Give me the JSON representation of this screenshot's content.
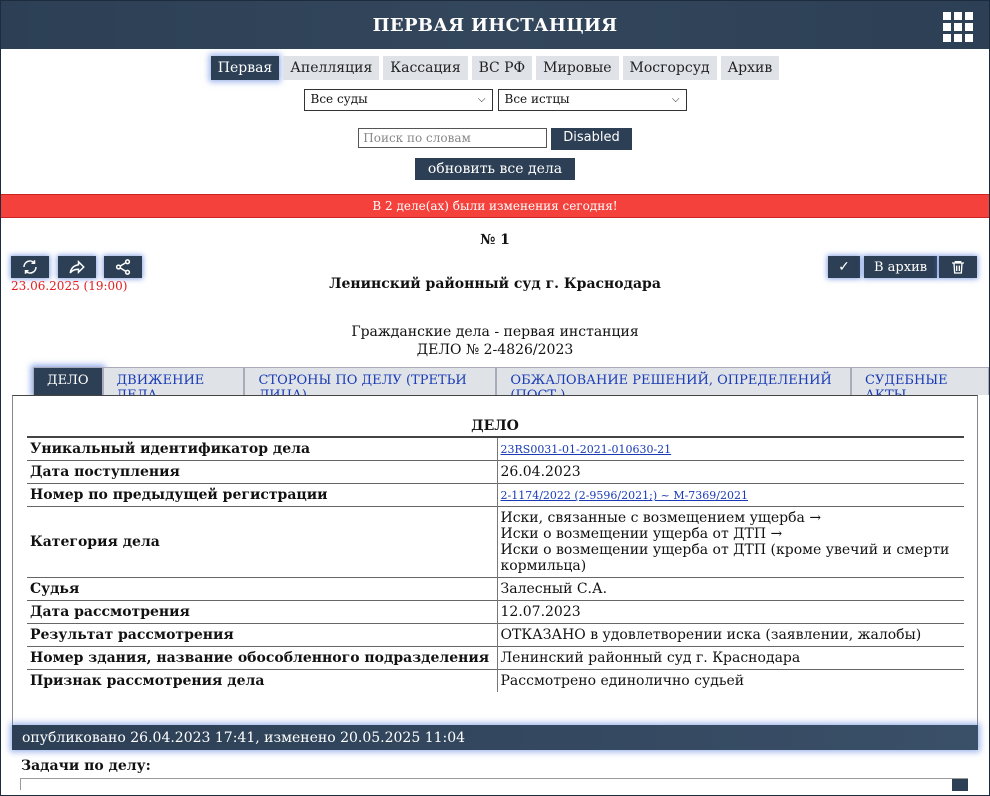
{
  "header": {
    "title": "ПЕРВАЯ ИНСТАНЦИЯ"
  },
  "courts": [
    "Первая",
    "Апелляция",
    "Кассация",
    "ВС РФ",
    "Мировые",
    "Мосгорсуд",
    "Архив"
  ],
  "filters": {
    "court_select": "Все суды",
    "plaintiff_select": "Все истцы"
  },
  "search": {
    "placeholder": "Поиск по словам",
    "disabled_label": "Disabled"
  },
  "refresh_label": "обновить все дела",
  "alert": "В 2 деле(ах) были изменения сегодня!",
  "case": {
    "number": "№ 1",
    "date": "23.06.2025 (19:00)",
    "court": "Ленинский районный суд г. Краснодара",
    "subtitle1": "Гражданские дела - первая инстанция",
    "subtitle2": "ДЕЛО № 2-4826/2023",
    "archive_label": "В архив",
    "check_label": "✓"
  },
  "tabs": [
    "ДЕЛО",
    "ДВИЖЕНИЕ ДЕЛА",
    "СТОРОНЫ ПО ДЕЛУ (ТРЕТЬИ ЛИЦА)",
    "ОБЖАЛОВАНИЕ РЕШЕНИЙ, ОПРЕДЕЛЕНИЙ (ПОСТ.)",
    "СУДЕБНЫЕ АКТЫ"
  ],
  "panel": {
    "title": "ДЕЛО",
    "rows": [
      {
        "key": "Уникальный идентификатор дела",
        "value": "23RS0031-01-2021-010630-21"
      },
      {
        "key": "Дата поступления",
        "value": "26.04.2023"
      },
      {
        "key": "Номер по предыдущей регистрации",
        "value": "2-1174/2022 (2-9596/2021;) ~ М-7369/2021"
      },
      {
        "key": "Категория дела",
        "value_lines": [
          "Иски, связанные с возмещением ущерба →",
          "Иски о возмещении ущерба от ДТП →",
          "Иски о возмещении ущерба от ДТП (кроме увечий и смерти кормильца)"
        ]
      },
      {
        "key": "Судья",
        "value": "Залесный С.А."
      },
      {
        "key": "Дата рассмотрения",
        "value": "12.07.2023"
      },
      {
        "key": "Результат рассмотрения",
        "value": "ОТКАЗАНО в удовлетворении иска (заявлении, жалобы)"
      },
      {
        "key": "Номер здания, название обособленного подразделения",
        "value": "Ленинский районный суд г. Краснодара"
      },
      {
        "key": "Признак рассмотрения дела",
        "value": "Рассмотрено единолично судьей"
      }
    ]
  },
  "footer": "опубликовано 26.04.2023 17:41, изменено 20.05.2025 11:04",
  "tasks_label": "Задачи по делу:"
}
